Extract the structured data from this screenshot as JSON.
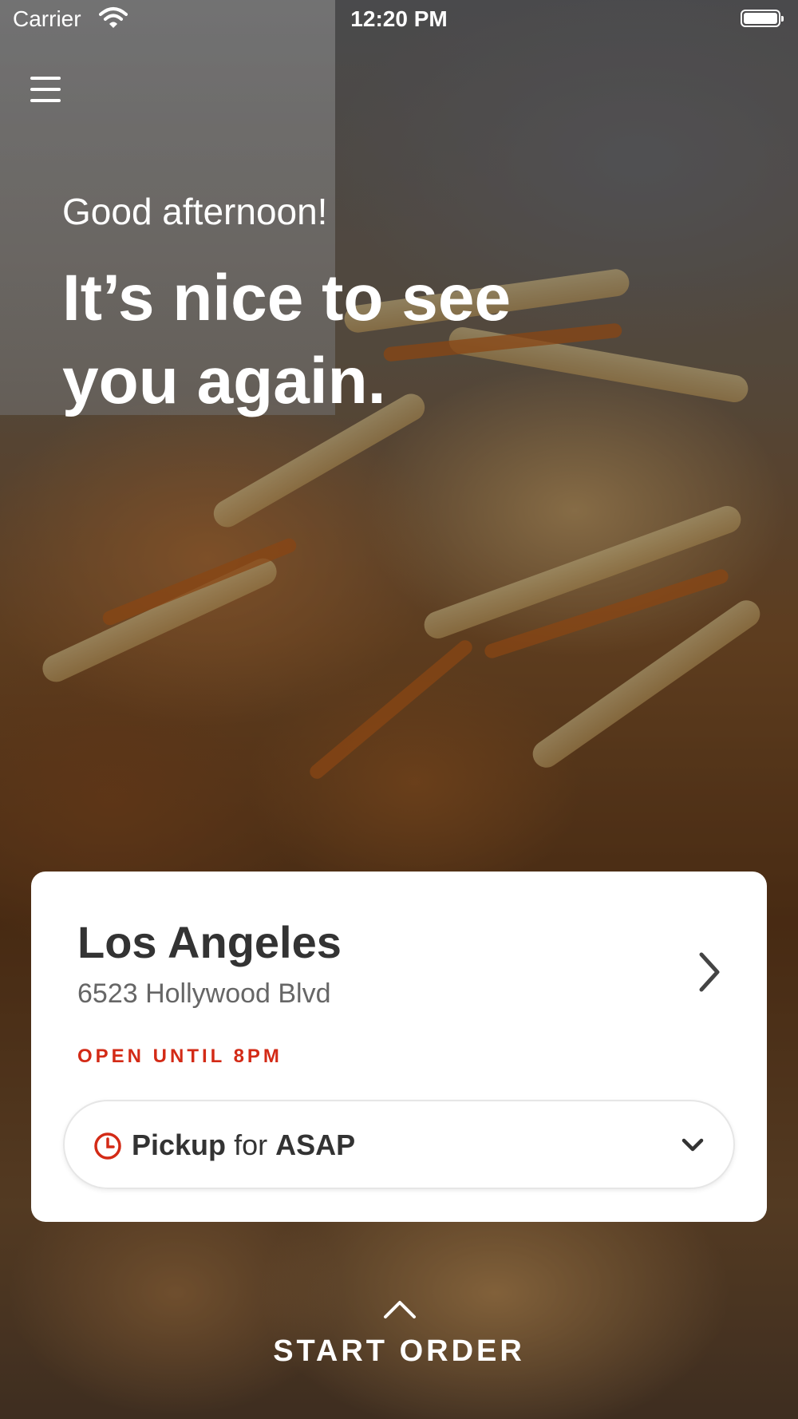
{
  "status_bar": {
    "carrier": "Carrier",
    "time": "12:20 PM"
  },
  "menu": {
    "icon": "hamburger-menu-icon"
  },
  "greeting": {
    "subtitle": "Good afternoon!",
    "headline": "It’s nice to see you again."
  },
  "location_card": {
    "city": "Los Angeles",
    "address": "6523 Hollywood Blvd",
    "hours": "OPEN UNTIL 8PM",
    "hours_color": "#d32a16",
    "chevron_icon": "chevron-right-icon"
  },
  "pickup_selector": {
    "mode": "Pickup",
    "connector": "for",
    "time": "ASAP",
    "clock_icon": "clock-icon",
    "chevron_icon": "chevron-down-icon",
    "accent_color": "#d32a16"
  },
  "start_order": {
    "label": "START ORDER",
    "arrow_icon": "chevron-up-icon"
  }
}
